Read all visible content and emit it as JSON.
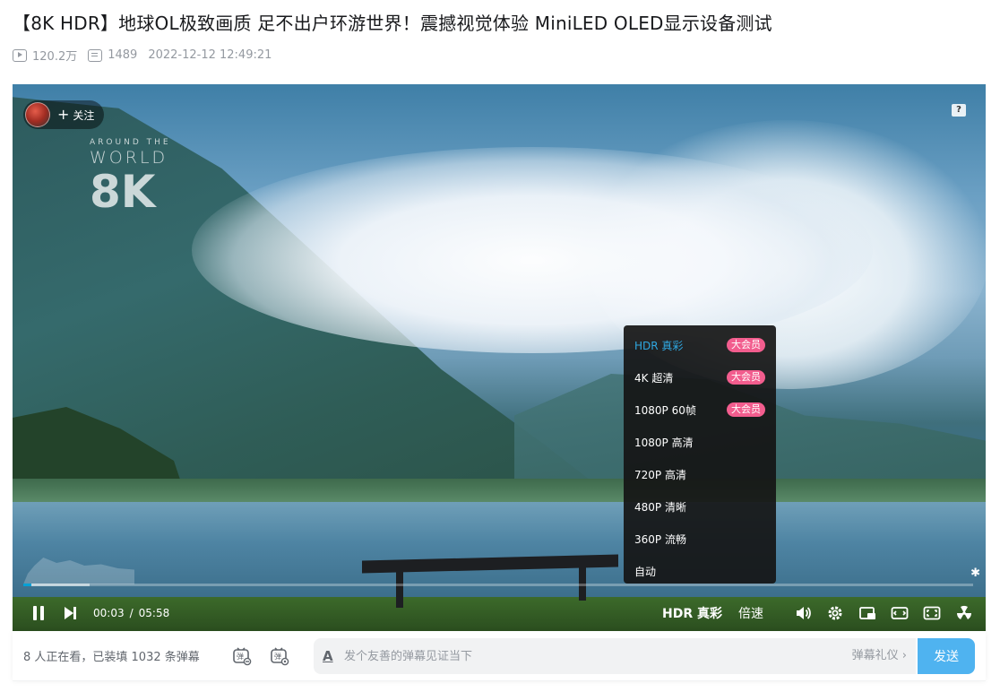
{
  "page": {
    "title": "【8K HDR】地球OL极致画质 足不出户环游世界！震撼视觉体验 MiniLED OLED显示设备测试",
    "views": "120.2万",
    "danmaku_count": "1489",
    "publish_time": "2022-12-12 12:49:21"
  },
  "player": {
    "follow_label": "关注",
    "follow_plus": "+",
    "help_icon": "?",
    "watermark": {
      "line1": "AROUND THE",
      "line2": "WORLD",
      "line3": "8K"
    },
    "progress_fraction": 0.0086,
    "buffer_fraction": 0.07,
    "time_current": "00:03",
    "time_separator": "/",
    "time_total": "05:58",
    "controls": {
      "quality_label": "HDR 真彩",
      "speed_label": "倍速"
    },
    "quality_menu": [
      {
        "label": "HDR 真彩",
        "badge": "大会员",
        "active": true
      },
      {
        "label": "4K 超清",
        "badge": "大会员",
        "active": false
      },
      {
        "label": "1080P 60帧",
        "badge": "大会员",
        "active": false
      },
      {
        "label": "1080P 高清",
        "badge": "",
        "active": false
      },
      {
        "label": "720P 高清",
        "badge": "",
        "active": false
      },
      {
        "label": "480P 清晰",
        "badge": "",
        "active": false
      },
      {
        "label": "360P 流畅",
        "badge": "",
        "active": false
      },
      {
        "label": "自动",
        "badge": "",
        "active": false
      }
    ]
  },
  "danmaku_bar": {
    "viewer_text": "8 人正在看，已装填 1032 条弹幕",
    "input_placeholder": "发个友善的弹幕见证当下",
    "input_value": "",
    "etiquette": "弹幕礼仪 ›",
    "send_label": "发送"
  },
  "colors": {
    "accent": "#00a1d6",
    "active_quality": "#2fa7e0",
    "vip_badge": "#f25d8e",
    "send_button": "#4fb3f0"
  }
}
